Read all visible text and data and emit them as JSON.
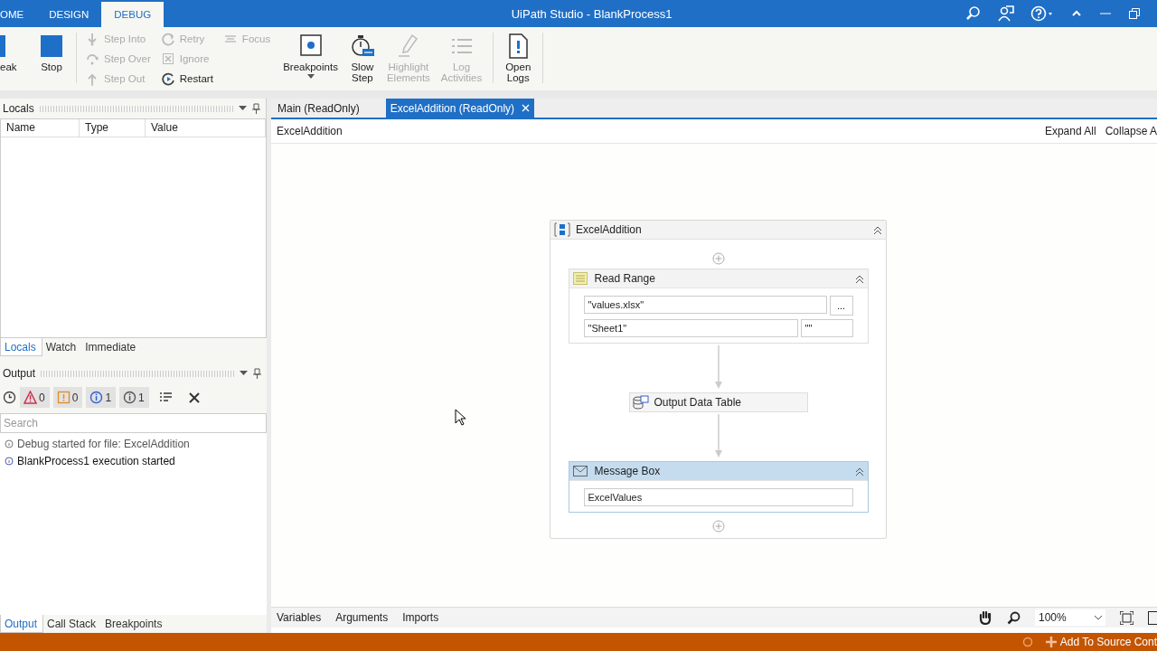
{
  "window": {
    "title": "UiPath Studio - BlankProcess1"
  },
  "ribbon_tabs": [
    {
      "label": "OME",
      "selected": false
    },
    {
      "label": "DESIGN",
      "selected": false
    },
    {
      "label": "DEBUG",
      "selected": true
    }
  ],
  "ribbon": {
    "left": [
      {
        "label": "eak",
        "disabled": false
      },
      {
        "label": "Stop",
        "disabled": false
      }
    ],
    "small_columns": [
      [
        {
          "label": "Step Into",
          "disabled": true
        },
        {
          "label": "Step Over",
          "disabled": true
        },
        {
          "label": "Step Out",
          "disabled": true
        }
      ],
      [
        {
          "label": "Retry",
          "disabled": true
        },
        {
          "label": "Ignore",
          "disabled": true
        },
        {
          "label": "Restart",
          "disabled": false
        }
      ],
      [
        {
          "label": "Focus",
          "disabled": true
        }
      ]
    ],
    "right": [
      {
        "label": "Breakpoints",
        "disabled": false,
        "dropdown": true
      },
      {
        "label": "Slow Step",
        "disabled": false,
        "dropdown": false
      },
      {
        "label": "Highlight Elements",
        "disabled": true,
        "dropdown": false
      },
      {
        "label": "Log Activities",
        "disabled": true,
        "dropdown": false
      }
    ],
    "logs": [
      {
        "label": "Open Logs",
        "disabled": false
      }
    ]
  },
  "locals": {
    "title": "Locals",
    "columns": [
      "Name",
      "Type",
      "Value"
    ]
  },
  "left_tabs": [
    {
      "label": "Locals",
      "selected": true
    },
    {
      "label": "Watch",
      "selected": false
    },
    {
      "label": "Immediate",
      "selected": false
    }
  ],
  "output": {
    "title": "Output",
    "filters": [
      {
        "kind": "error",
        "count": "0"
      },
      {
        "kind": "warning",
        "count": "0"
      },
      {
        "kind": "info",
        "count": "1"
      },
      {
        "kind": "trace",
        "count": "1"
      }
    ],
    "search": {
      "placeholder": "Search"
    },
    "log": [
      {
        "kind": "trace",
        "text": "Debug started for file: ExcelAddition"
      },
      {
        "kind": "info",
        "text": "BlankProcess1 execution started"
      }
    ]
  },
  "bottom_tabs": [
    {
      "label": "Output",
      "selected": true
    },
    {
      "label": "Call Stack",
      "selected": false
    },
    {
      "label": "Breakpoints",
      "selected": false
    }
  ],
  "doc_tabs": [
    {
      "label": "Main (ReadOnly)",
      "selected": false
    },
    {
      "label": "ExcelAddition (ReadOnly)",
      "selected": true
    }
  ],
  "breadcrumb": "ExcelAddition",
  "expand_all": "Expand All",
  "collapse_all": "Collapse A",
  "sequence": {
    "title": "ExcelAddition",
    "activities": [
      {
        "kind": "read_range",
        "title": "Read Range",
        "selected": false,
        "path": "\"values.xlsx\"",
        "browse": "...",
        "sheet": "\"Sheet1\"",
        "range": "\"\""
      },
      {
        "kind": "compact",
        "title": "Output Data Table",
        "selected": false
      },
      {
        "kind": "message",
        "title": "Message Box",
        "selected": true,
        "text": "ExcelValues"
      }
    ]
  },
  "designer_tabs": [
    "Variables",
    "Arguments",
    "Imports"
  ],
  "zoom": "100%",
  "status_bar": {
    "source_control": "Add To Source Cont"
  }
}
